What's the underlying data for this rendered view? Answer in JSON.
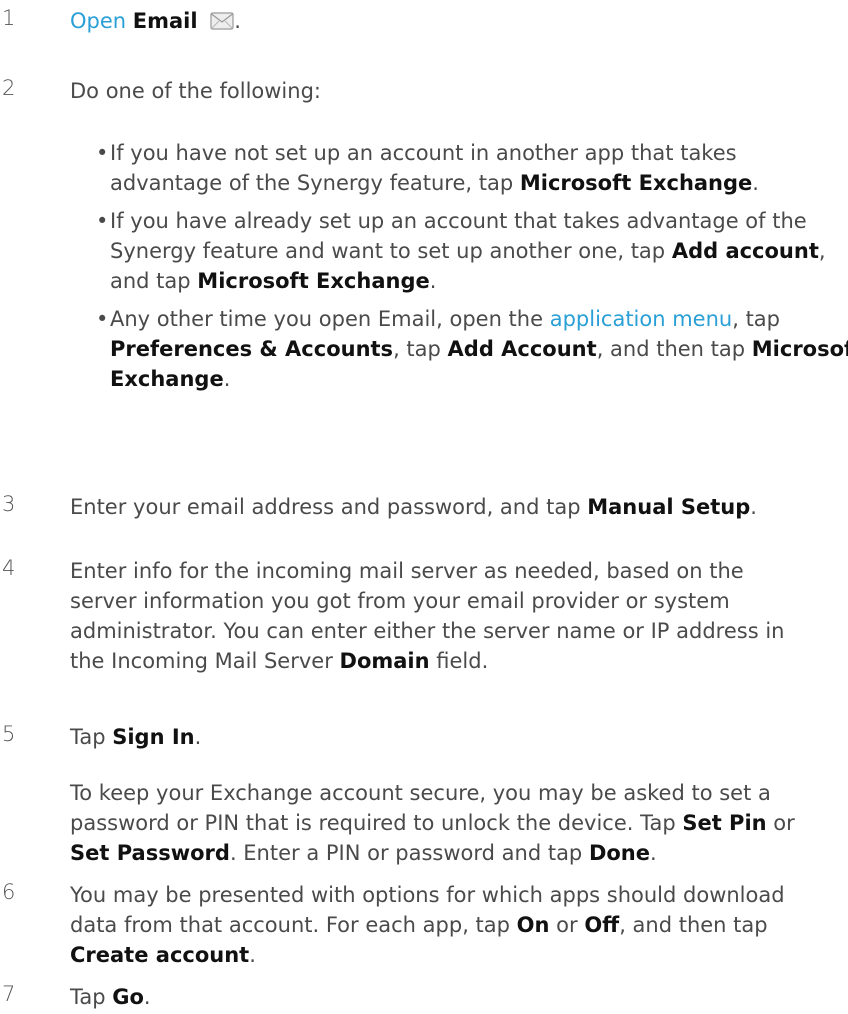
{
  "step1": {
    "number": "1",
    "link": "Open",
    "app": "Email",
    "period": ".",
    "icon": "envelope-icon"
  },
  "step2": {
    "number": "2",
    "intro": "Do one of the following:",
    "bullets": [
      {
        "l1": "If you have not set up an account in another app that takes",
        "l2a": "advantage of the Synergy feature, tap ",
        "l2b": "Microsoft Exchange",
        "l2c": "."
      },
      {
        "l1": "If you have already set up an account that takes advantage of the",
        "l2a": "Synergy feature and want to set up another one, tap ",
        "l2b": "Add account",
        "l2c": ",",
        "l3a": "and tap ",
        "l3b": "Microsoft Exchange",
        "l3c": "."
      },
      {
        "l1a": "Any other time you open Email, open the ",
        "l1link": "application menu",
        "l1c": ", tap",
        "l2a": "Preferences & Accounts",
        "l2b": ", tap ",
        "l2c": "Add Account",
        "l2d": ", and then tap ",
        "l2e": "Microsoft",
        "l3a": "Exchange",
        "l3b": "."
      }
    ]
  },
  "step3": {
    "number": "3",
    "a": "Enter your email address and password, and tap ",
    "b": "Manual Setup",
    "c": "."
  },
  "step4": {
    "number": "4",
    "l1": "Enter info for the incoming mail server as needed, based on the",
    "l2": "server information you got from your email provider or system",
    "l3": "administrator. You can enter either the server name or IP address in",
    "l4a": "the Incoming Mail Server ",
    "l4b": "Domain",
    "l4c": " field."
  },
  "step5": {
    "number": "5",
    "a": "Tap ",
    "b": "Sign In",
    "c": ".",
    "p1": "To keep your Exchange account secure, you may be asked to set a",
    "p2a": "password or PIN that is required to unlock the device. Tap ",
    "p2b": "Set Pin",
    "p2c": " or",
    "p3a": "Set Password",
    "p3b": ". Enter a PIN or password and tap ",
    "p3c": "Done",
    "p3d": "."
  },
  "step6": {
    "number": "6",
    "l1": "You may be presented with options for which apps should download",
    "l2a": "data from that account. For each app, tap ",
    "l2b": "On",
    "l2c": " or ",
    "l2d": "Off",
    "l2e": ", and then tap",
    "l3a": "Create account",
    "l3b": "."
  },
  "step7": {
    "number": "7",
    "a": "Tap ",
    "b": "Go",
    "c": "."
  },
  "colors": {
    "link": "#2aa0d6",
    "text": "#4a4a4a",
    "bold": "#111111"
  }
}
